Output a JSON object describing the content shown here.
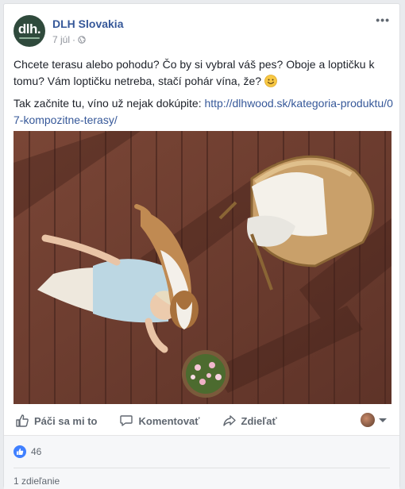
{
  "post": {
    "page_name": "DLH Slovakia",
    "date": "7 júl",
    "dot": "·",
    "more_label": "•••",
    "avatar_text": "dlh.",
    "paragraph1": "Chcete terasu alebo pohodu? Čo by si vybral váš pes? Oboje a loptičku k tomu? Vám loptičku netreba, stačí pohár vína, že?",
    "paragraph2_prefix": "Tak začnite tu, víno už nejak dokúpite: ",
    "link": "http://dlhwood.sk/kategoria-produktu/07-kompozitne-terasy/"
  },
  "actions": {
    "like": "Páči sa mi to",
    "comment": "Komentovať",
    "share": "Zdieľať"
  },
  "stats": {
    "likes": "46",
    "shares": "1 zdieľanie"
  },
  "colors": {
    "link": "#365899",
    "like_badge": "#4080ff",
    "deck": "#6e3f32",
    "avatar_bg": "#2f4a3c"
  },
  "icons": {
    "globe": "globe-icon",
    "like": "thumbs-up-icon",
    "comment": "comment-icon",
    "share": "share-icon",
    "smile": "smile-emoji-icon"
  }
}
